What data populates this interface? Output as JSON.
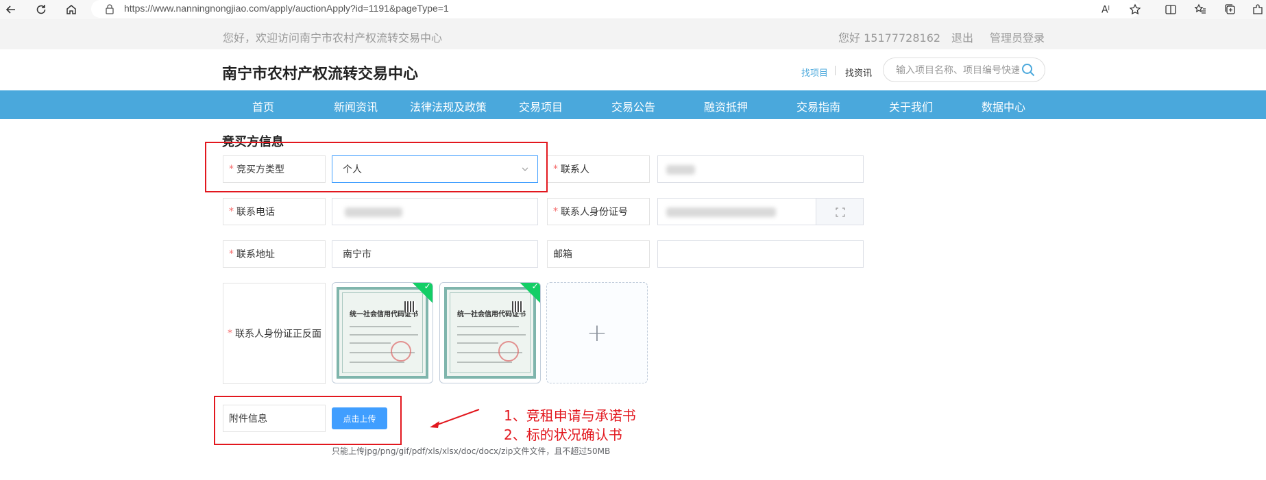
{
  "browser": {
    "url": "https://www.nanningnongjiao.com/apply/auctionApply?id=1191&pageType=1"
  },
  "topbar": {
    "welcome": "您好，欢迎访问南宁市农村产权流转交易中心",
    "user": "您好 15177728162",
    "logout": "退出",
    "admin_login": "管理员登录"
  },
  "header": {
    "site_title": "南宁市农村产权流转交易中心",
    "find_project": "找项目",
    "find_news": "找资讯",
    "search_placeholder": "输入项目名称、项目编号快速",
    "accent": "#4aa8dc"
  },
  "nav": {
    "items": [
      "首页",
      "新闻资讯",
      "法律法规及政策",
      "交易项目",
      "交易公告",
      "融资抵押",
      "交易指南",
      "关于我们",
      "数据中心"
    ]
  },
  "form": {
    "section_title": "竞买方信息",
    "bidder_type_label": "竞买方类型",
    "bidder_type_value": "个人",
    "contact_label": "联系人",
    "phone_label": "联系电话",
    "id_number_label": "联系人身份证号",
    "address_label": "联系地址",
    "address_value": "南宁市",
    "email_label": "邮箱",
    "email_value": "",
    "id_photo_label": "联系人身份证正反面",
    "cert_title": "统一社会信用代码证书",
    "attachment_label": "附件信息",
    "upload_button": "点击上传",
    "upload_hint": "只能上传jpg/png/gif/pdf/xls/xlsx/doc/docx/zip文件文件，且不超过50MB"
  },
  "annotation": {
    "line1": "1、竞租申请与承诺书",
    "line2": "2、标的状况确认书",
    "color": "#e2171e"
  }
}
